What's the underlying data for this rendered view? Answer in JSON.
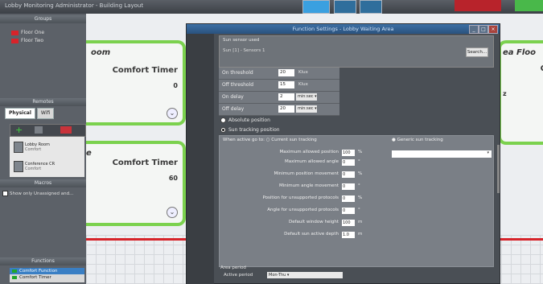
{
  "window": {
    "title": "Lobby Monitoring Administrator - Building Layout"
  },
  "groups": {
    "header": "Groups",
    "items": [
      {
        "label": "Floor One"
      },
      {
        "label": "Floor Two"
      }
    ]
  },
  "remotes": {
    "header": "Remotes",
    "tabs": [
      "Physical",
      "Wifi"
    ],
    "items": [
      {
        "name": "Lobby Room",
        "sub": "Comfort"
      },
      {
        "name": "Conference CR",
        "sub": "Comfort"
      }
    ]
  },
  "macros": {
    "header": "Macros",
    "checkbox_label": "Show only Unassigned and..."
  },
  "functions": {
    "header": "Functions",
    "items": [
      {
        "label": "Comfort Function"
      },
      {
        "label": "Comfort Timer"
      }
    ]
  },
  "cards": [
    {
      "room": "oom",
      "timer": "Comfort Timer",
      "value": "0"
    },
    {
      "room": "e",
      "timer": "Comfort Timer",
      "value": "60"
    },
    {
      "room": "ea Floo",
      "timer": "C",
      "value": "z"
    }
  ],
  "dialog": {
    "title": "Function Settings - Lobby Waiting Area",
    "sensor": {
      "label": "Sun sensor used",
      "value": "Sun [1] - Sensors 1",
      "button": "Search..."
    },
    "params": [
      {
        "label": "On threshold",
        "value": "20",
        "unit": "Klux"
      },
      {
        "label": "Off threshold",
        "value": "15",
        "unit": "Klux"
      },
      {
        "label": "On delay",
        "value": "2",
        "select": "min:sec ▾"
      },
      {
        "label": "Off delay",
        "value": "20",
        "select": "min:sec ▾"
      }
    ],
    "radio_absolute": "Absolute position",
    "radio_sun": "Sun tracking position",
    "advanced": {
      "when_label": "When active go to:",
      "option1": "Current sun tracking",
      "option2": "Generic sun tracking",
      "rows": [
        {
          "label": "Maximum allowed position",
          "value": "100",
          "unit": "%"
        },
        {
          "label": "Maximum allowed angle",
          "value": "0",
          "unit": "°"
        },
        {
          "label": "Minimum position movement",
          "value": "0",
          "unit": "%"
        },
        {
          "label": "Minimum angle movement",
          "value": "0",
          "unit": "°"
        },
        {
          "label": "Position for unsupported protocols",
          "value": "0",
          "unit": "%"
        },
        {
          "label": "Angle for unsupported protocols",
          "value": "0",
          "unit": "°"
        },
        {
          "label": "Default window height",
          "value": "100",
          "unit": "m"
        },
        {
          "label": "Default sun active depth",
          "value": "1.0",
          "unit": "m"
        }
      ]
    },
    "area": {
      "label": "Area period",
      "sub_label": "Active period",
      "select": "Mon-Thu ▾"
    }
  }
}
